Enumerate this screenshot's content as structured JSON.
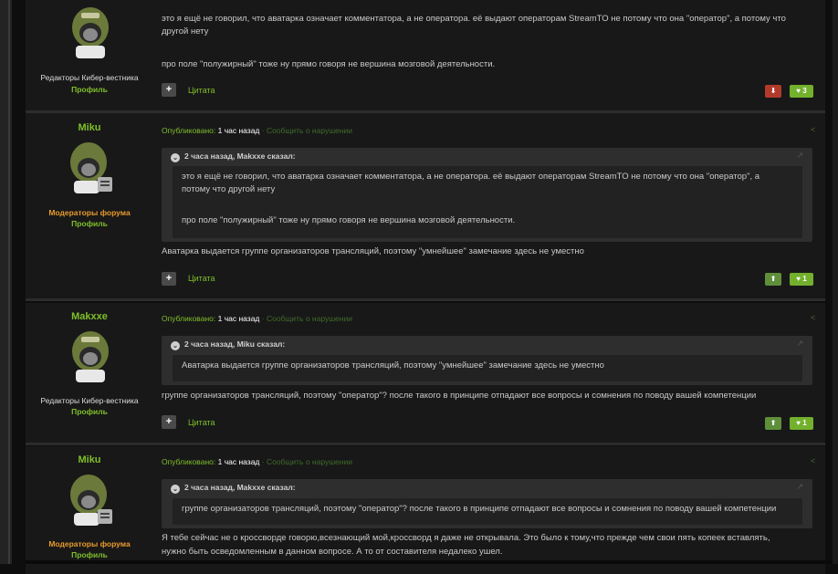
{
  "common": {
    "published_label": "Опубликовано:",
    "published_time": "1 час назад",
    "report_link": "· Сообщить о нарушении",
    "profile_label": "Профиль",
    "cite_label": "Цитата",
    "plus_glyph": "+"
  },
  "posts": [
    {
      "author": "",
      "group": "Редакторы Кибер-вестника",
      "text_lines": [
        "это я ещё не говорил, что аватарка означает комментатора, а не оператора. её выдают операторам StreamTO не потому что она \"оператор\", а потому что",
        "другой нету",
        "про поле \"полужирный\" тоже ну прямо говоря не вершина мозговой деятельности."
      ],
      "downvote": "",
      "reputation": "3"
    },
    {
      "author": "Miku",
      "group": "Модераторы форума",
      "quote_header": "2 часа назад, Makxxe сказал:",
      "quote_lines": [
        "это я ещё не говорил, что аватарка означает комментатора, а не оператора. её выдают операторам StreamTO не потому что она \"оператор\", а",
        "потому что другой нету",
        "про поле \"полужирный\" тоже ну прямо говоря не вершина мозговой деятельности."
      ],
      "text_lines": [
        "Аватарка выдается группе организаторов трансляций, поэтому \"умнейшее\" замечание здесь не уместно"
      ],
      "reputation": "1"
    },
    {
      "author": "Makxxe",
      "group": "Редакторы Кибер-вестника",
      "quote_header": "2 часа назад, Miku сказал:",
      "quote_lines": [
        "Аватарка выдается группе организаторов трансляций, поэтому \"умнейшее\" замечание здесь не уместно"
      ],
      "text_lines": [
        "группе организаторов трансляций, поэтому \"оператор\"? после такого в принципе отпадают все вопросы и сомнения по поводу вашей компетенции"
      ],
      "reputation": "1"
    },
    {
      "author": "Miku",
      "group": "Модераторы форума",
      "quote_header": "2 часа назад, Makxxe сказал:",
      "quote_lines": [
        "группе организаторов трансляций, поэтому \"оператор\"? после такого в принципе отпадают все вопросы и сомнения по поводу вашей компетенции"
      ],
      "text_lines": [
        "Я тебе сейчас не о кроссворде говорю,всезнающий мой,кроссворд я даже не открывала. Это было к тому,что прежде чем свои пять копеек вставлять,",
        "нужно быть осведомленным в данном вопросе. А то от составителя недалеко ушел."
      ]
    }
  ]
}
